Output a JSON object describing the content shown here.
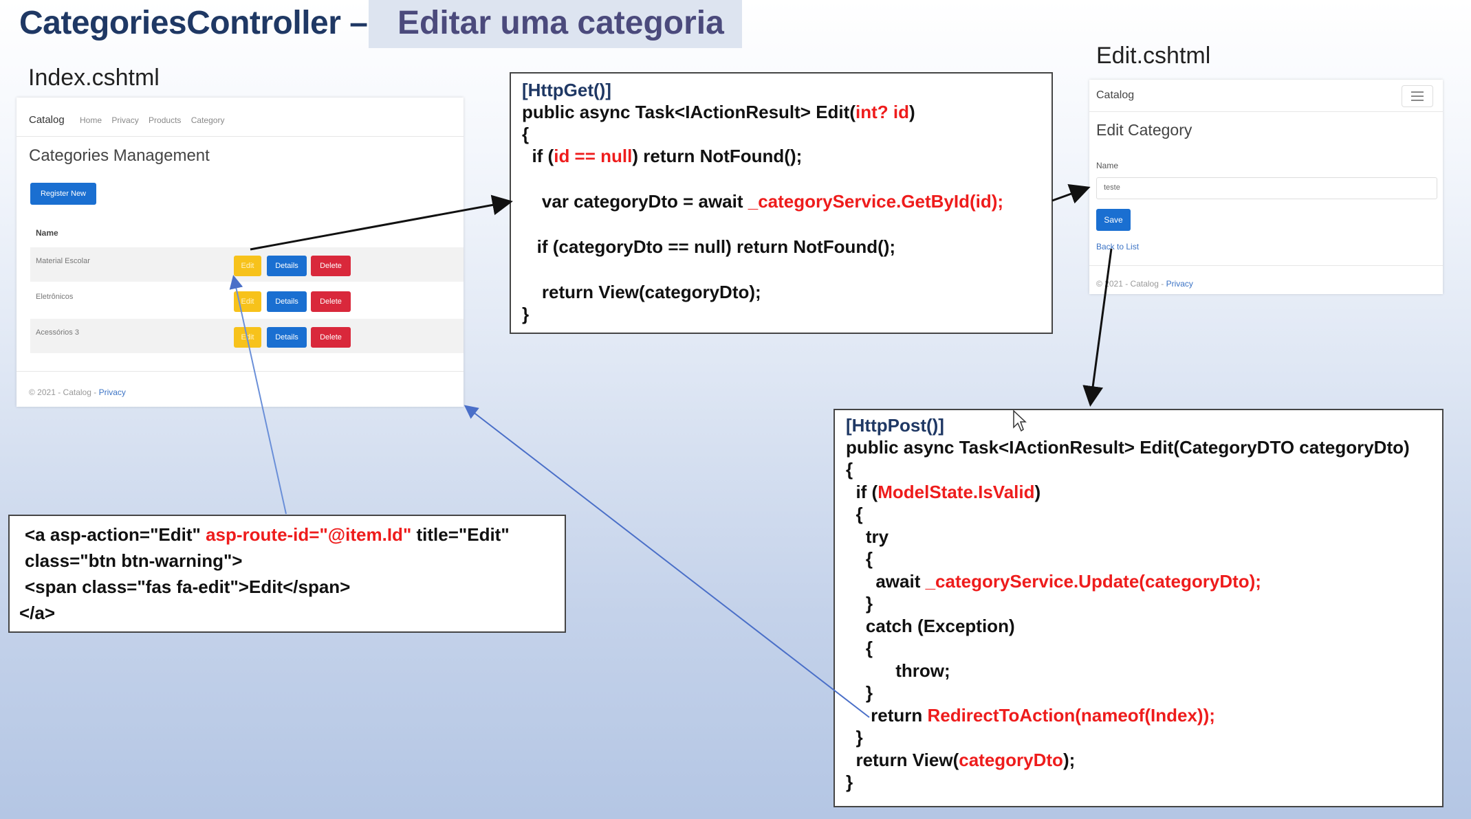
{
  "header": {
    "title_main": "CategoriesController –",
    "title_sub": "Editar uma categoria"
  },
  "index_panel": {
    "label": "Index.cshtml",
    "brand": "Catalog",
    "nav": [
      "Home",
      "Privacy",
      "Products",
      "Category"
    ],
    "page_title": "Categories Management",
    "register_button": "Register New",
    "column_header": "Name",
    "rows": [
      {
        "name": "Material Escolar",
        "edit": "Edit",
        "details": "Details",
        "delete": "Delete"
      },
      {
        "name": "Eletrônicos",
        "edit": "Edit",
        "details": "Details",
        "delete": "Delete"
      },
      {
        "name": "Acessórios 3",
        "edit": "Edit",
        "details": "Details",
        "delete": "Delete"
      }
    ],
    "footer_text": "© 2021 - Catalog -",
    "footer_link": "Privacy"
  },
  "edit_panel": {
    "label": "Edit.cshtml",
    "brand": "Catalog",
    "page_title": "Edit Category",
    "field_label": "Name",
    "field_value": "teste",
    "save_button": "Save",
    "back_link": "Back to List",
    "footer_text": "© 2021 - Catalog -",
    "footer_link": "Privacy"
  },
  "get_code": {
    "attr": "[HttpGet()]",
    "l1a": "public async Task<IActionResult> Edit(",
    "l1b": "int? id",
    "l1c": ")",
    "l2": "{",
    "l3a": "  if (",
    "l3b": "id == null",
    "l3c": ") return NotFound();",
    "l4a": "    var categoryDto = await ",
    "l4b": "_categoryService.GetById(id);",
    "l5": "   if (categoryDto == null) return NotFound();",
    "l6": "    return View(categoryDto);",
    "l7": "}"
  },
  "anchor_code": {
    "l1a": "<a asp-action=\"Edit\" ",
    "l1b": "asp-route-id=\"@item.Id\"",
    "l1c": " title=\"Edit\"",
    "l2": "class=\"btn btn-warning\">",
    "l3": "<span class=\"fas fa-edit\">Edit</span>",
    "l4": "</a>"
  },
  "post_code": {
    "attr": "[HttpPost()]",
    "l1": "public async Task<IActionResult> Edit(CategoryDTO categoryDto)",
    "l2": "{",
    "l3a": "  if (",
    "l3b": "ModelState.IsValid",
    "l3c": ")",
    "l4": "  {",
    "l5": "    try",
    "l6": "    {",
    "l7a": "      await ",
    "l7b": "_categoryService.Update(categoryDto);",
    "l8": "    }",
    "l9": "    catch (Exception)",
    "l10": "    {",
    "l11": "          throw;",
    "l12": "    }",
    "l13a": "     return ",
    "l13b": "RedirectToAction(nameof(Index));",
    "l14": "  }",
    "l15a": "  return View(",
    "l15b": "categoryDto",
    "l15c": ");",
    "l16": "}"
  },
  "colors": {
    "title": "#1f3864",
    "code_highlight": "#ee1c1c",
    "primary_button": "#1a6fd1",
    "warning_button": "#f7c21b",
    "danger_button": "#d9283b"
  }
}
